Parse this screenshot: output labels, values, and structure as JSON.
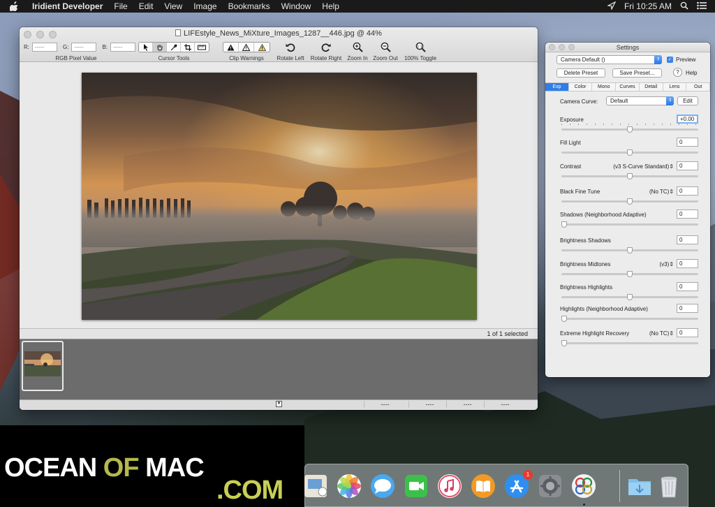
{
  "menubar": {
    "app_name": "Iridient Developer",
    "items": [
      "File",
      "Edit",
      "View",
      "Image",
      "Bookmarks",
      "Window",
      "Help"
    ],
    "clock": "Fri 10:25 AM"
  },
  "main_window": {
    "title": "LIFEstyle_News_MiXture_Images_1287__446.jpg @ 44%",
    "toolbar": {
      "rgb": {
        "r_label": "R:",
        "g_label": "G:",
        "b_label": "B:",
        "r_value": "-----",
        "g_value": "-----",
        "b_value": "-----",
        "group_label": "RGB Pixel Value"
      },
      "cursor_tools_label": "Cursor Tools",
      "clip_warnings_label": "Clip Warnings",
      "rotate_left": "Rotate Left",
      "rotate_right": "Rotate Right",
      "zoom_in": "Zoom In",
      "zoom_out": "Zoom Out",
      "toggle_100": "100% Toggle"
    },
    "status": "1 of 1 selected",
    "bottom_cells": [
      "----",
      "----",
      "----",
      "----"
    ]
  },
  "settings": {
    "title": "Settings",
    "preset_popup": "Camera Default ()",
    "preview_label": "Preview",
    "preview_checked": true,
    "delete_preset": "Delete Preset",
    "save_preset": "Save Preset...",
    "help": "Help",
    "tabs": [
      "Exp",
      "Color",
      "Mono",
      "Curves",
      "Detail",
      "Lens",
      "Out"
    ],
    "active_tab": "Exp",
    "camera_curve_label": "Camera Curve:",
    "camera_curve_value": "Default",
    "edit_button": "Edit",
    "controls": [
      {
        "label": "Exposure",
        "mode": "",
        "value": "+0.00",
        "level": 0.5
      },
      {
        "label": "Fill Light",
        "mode": "",
        "value": "0",
        "level": 0.5
      },
      {
        "label": "Contrast",
        "mode": "(v3 S-Curve Standard)",
        "value": "0",
        "level": 0.5
      },
      {
        "label": "Black Fine Tune",
        "mode": "(No TC)",
        "value": "0",
        "level": 0.5
      },
      {
        "label": "Shadows (Neighborhood Adaptive)",
        "mode": "",
        "value": "0",
        "level": 0.0
      },
      {
        "label": "Brightness Shadows",
        "mode": "",
        "value": "0",
        "level": 0.5
      },
      {
        "label": "Brightness Midtones",
        "mode": "(v3)",
        "value": "0",
        "level": 0.5
      },
      {
        "label": "Brightness Highlights",
        "mode": "",
        "value": "0",
        "level": 0.5
      },
      {
        "label": "Highlights (Neighborhood Adaptive)",
        "mode": "",
        "value": "0",
        "level": 0.0
      },
      {
        "label": "Extreme Highlight Recovery",
        "mode": "(No TC)",
        "value": "0",
        "level": 0.0
      }
    ]
  },
  "dock": {
    "icons": [
      "photos-icon",
      "messages-icon",
      "facetime-icon",
      "itunes-icon",
      "ibooks-icon",
      "app-store-icon",
      "system-preferences-icon",
      "iridient-icon",
      "downloads-folder-icon",
      "trash-icon"
    ],
    "app_store_badge": "1"
  },
  "watermark": {
    "word1": "OCEAN",
    "word2": "OF",
    "word3": "MAC",
    "word4": ".COM"
  },
  "colors": {
    "accent": "#2f7de8",
    "menubar": "#1a1a1a",
    "watermark_green": "#c8cf52"
  }
}
